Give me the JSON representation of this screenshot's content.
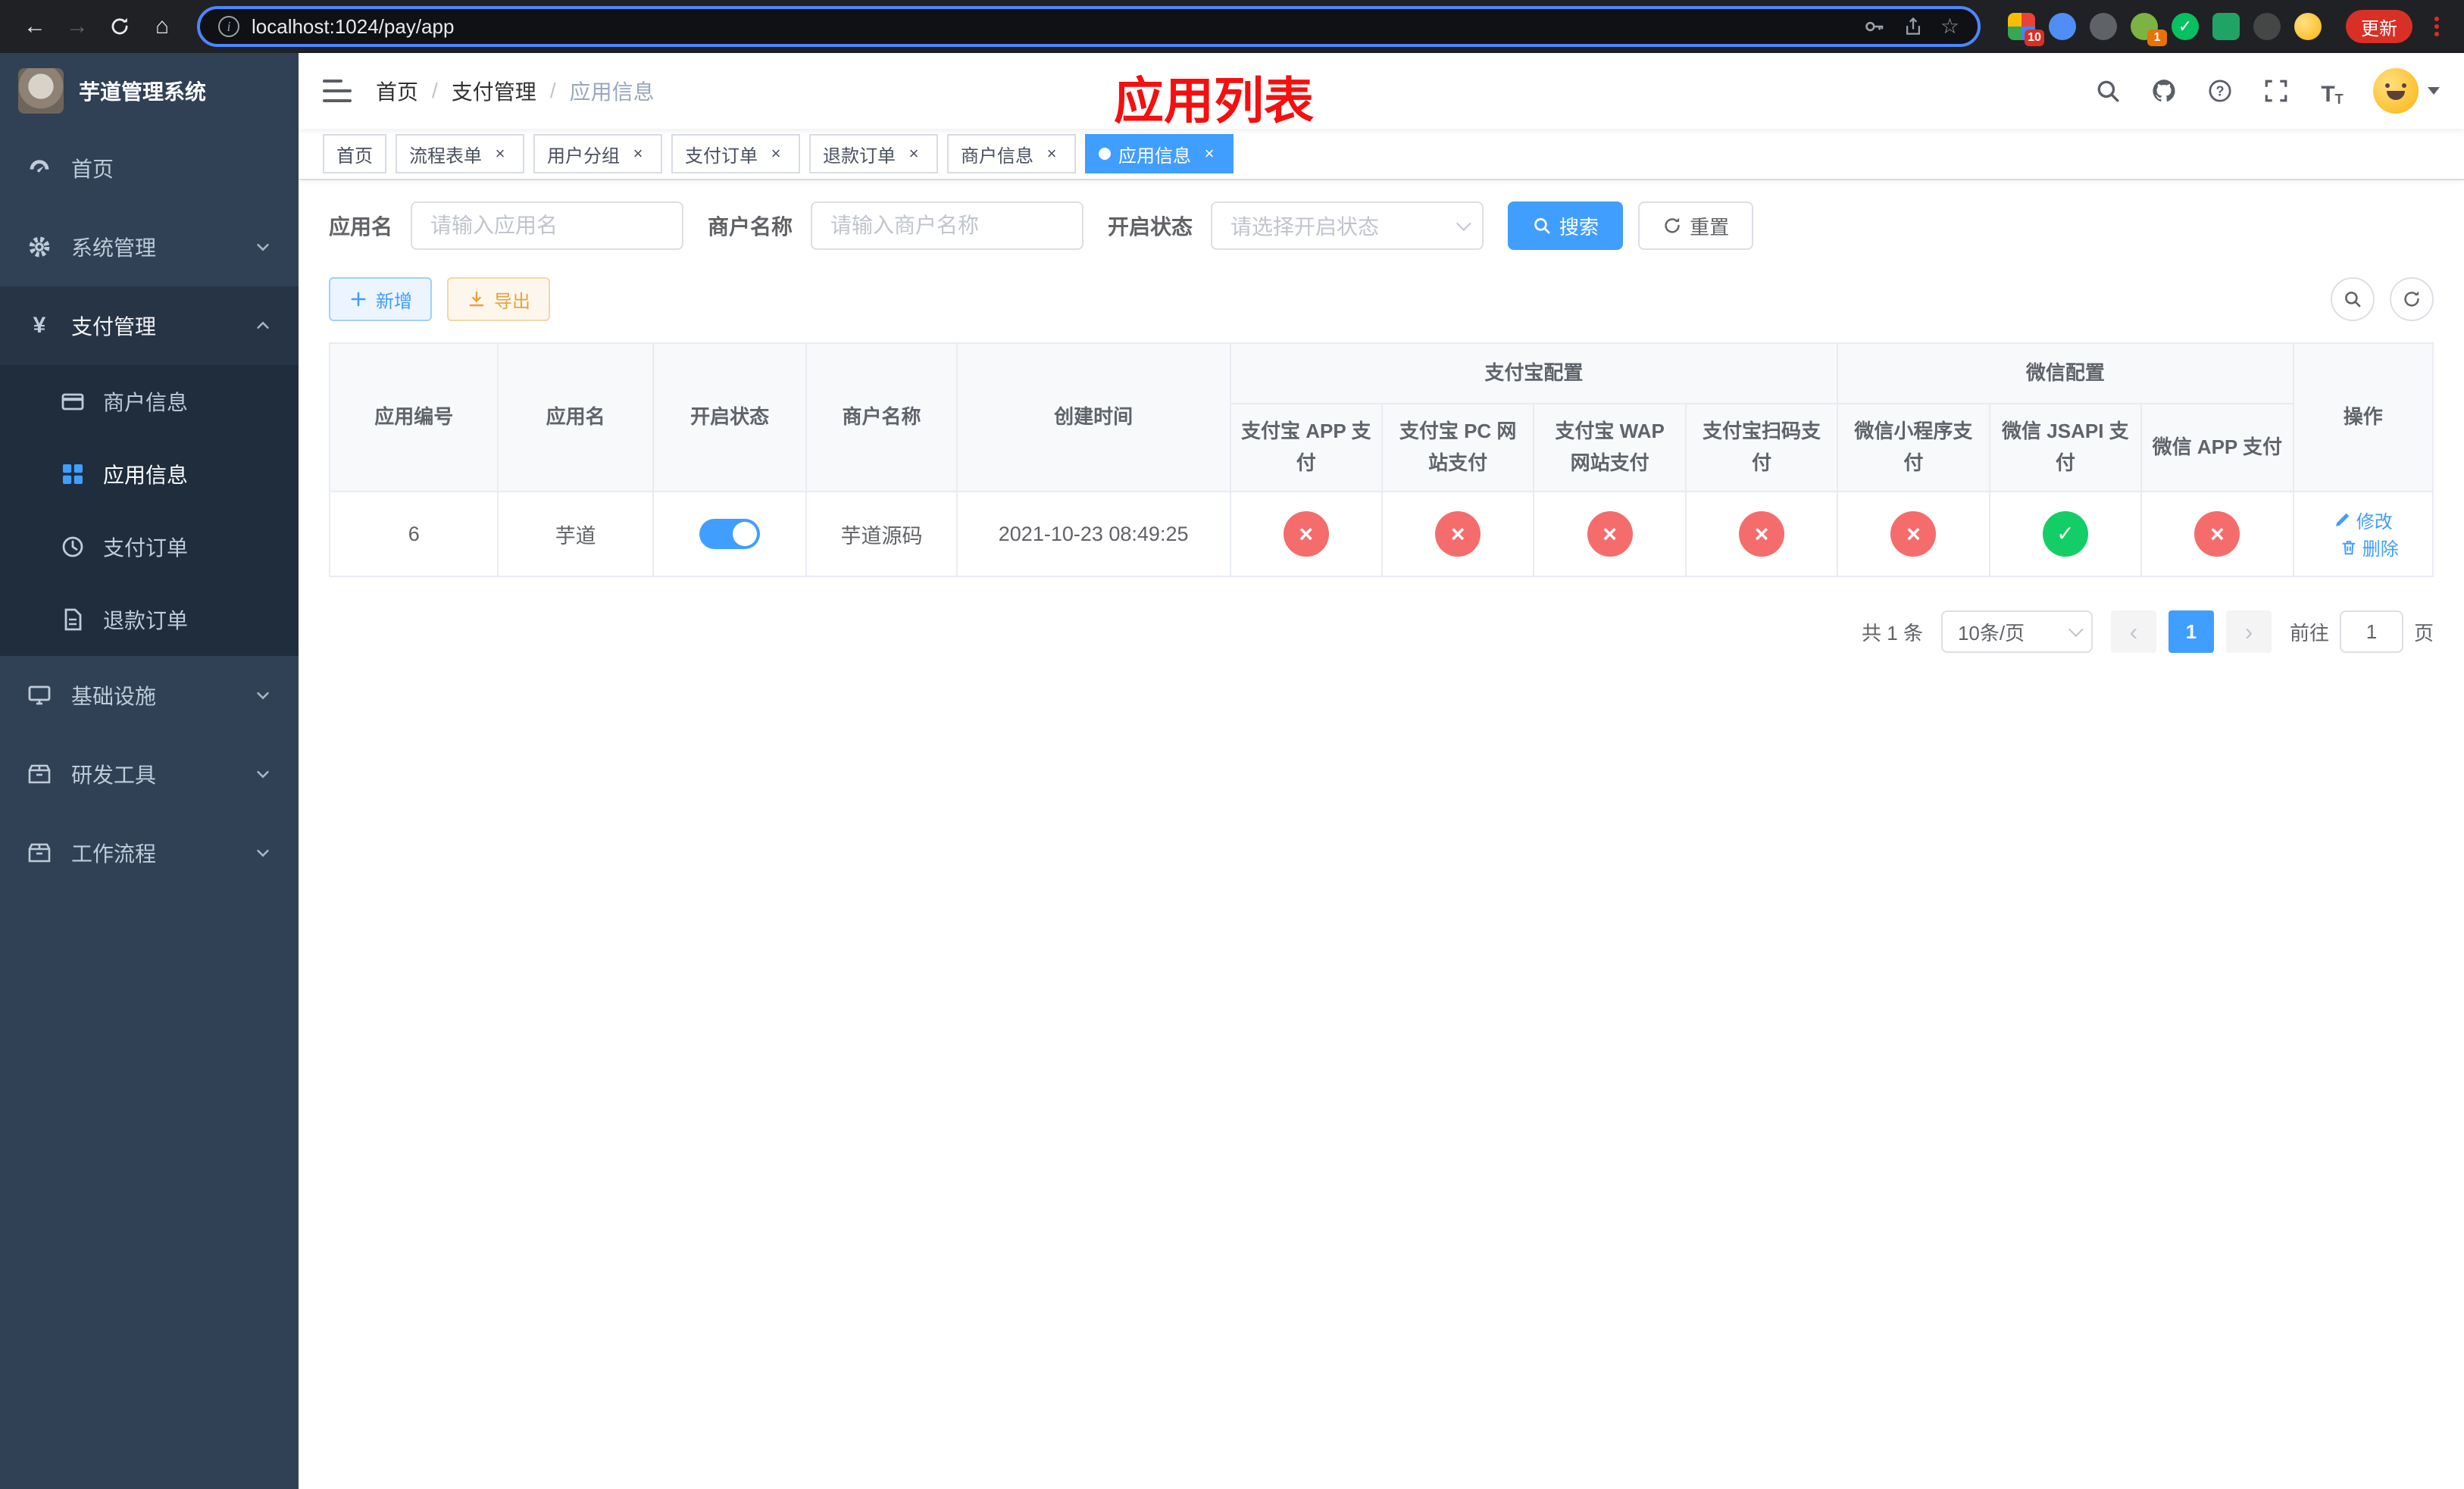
{
  "browser": {
    "url": "localhost:1024/pay/app",
    "update_label": "更新",
    "ext_badge_1": "10",
    "ext_badge_2": "1"
  },
  "sidebar": {
    "title": "芋道管理系统",
    "home": "首页",
    "system": "系统管理",
    "payment": "支付管理",
    "sub_merchant": "商户信息",
    "sub_app": "应用信息",
    "sub_order": "支付订单",
    "sub_refund": "退款订单",
    "infra": "基础设施",
    "devtools": "研发工具",
    "workflow": "工作流程"
  },
  "header": {
    "breadcrumb": [
      "首页",
      "支付管理",
      "应用信息"
    ],
    "separator": "/",
    "annotation": "应用列表"
  },
  "tabs": {
    "items": [
      "首页",
      "流程表单",
      "用户分组",
      "支付订单",
      "退款订单",
      "商户信息",
      "应用信息"
    ],
    "active_index": 6
  },
  "filters": {
    "app_name_label": "应用名",
    "app_name_placeholder": "请输入应用名",
    "merchant_label": "商户名称",
    "merchant_placeholder": "请输入商户名称",
    "status_label": "开启状态",
    "status_placeholder": "请选择开启状态",
    "search_label": "搜索",
    "reset_label": "重置"
  },
  "toolbar": {
    "add_label": "新增",
    "export_label": "导出"
  },
  "table": {
    "headers": {
      "id": "应用编号",
      "name": "应用名",
      "status": "开启状态",
      "merchant": "商户名称",
      "created": "创建时间",
      "alipay_group": "支付宝配置",
      "wechat_group": "微信配置",
      "actions": "操作",
      "channels": [
        "支付宝 APP 支付",
        "支付宝 PC 网站支付",
        "支付宝 WAP 网站支付",
        "支付宝扫码支付",
        "微信小程序支付",
        "微信 JSAPI 支付",
        "微信 APP 支付"
      ]
    },
    "row": {
      "id": "6",
      "name": "芋道",
      "enabled": true,
      "merchant": "芋道源码",
      "created": "2021-10-23 08:49:25",
      "statuses": [
        false,
        false,
        false,
        false,
        false,
        true,
        false
      ],
      "edit_label": "修改",
      "delete_label": "删除"
    }
  },
  "pagination": {
    "total": "共 1 条",
    "page_size": "10条/页",
    "current": "1",
    "goto_prefix": "前往",
    "goto_value": "1",
    "goto_suffix": "页"
  },
  "colors": {
    "primary": "#409eff",
    "danger": "#f56c6c",
    "success": "#13ce66",
    "warning": "#e6a23c",
    "sidebar_bg": "#304156",
    "submenu_bg": "#1f2d3d",
    "annotation_red": "#f50f0f"
  }
}
